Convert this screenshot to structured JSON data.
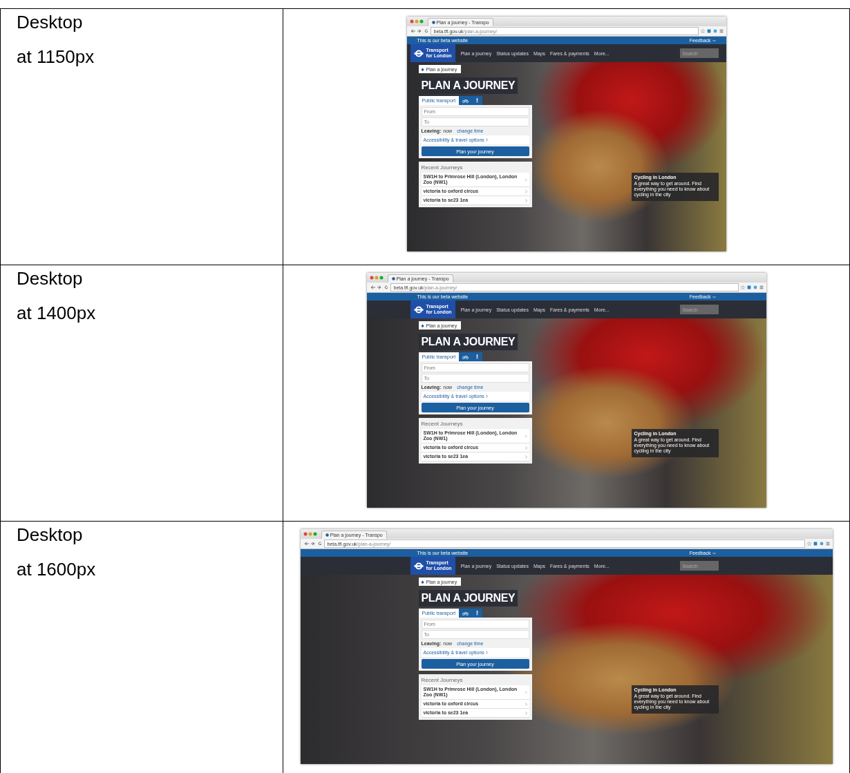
{
  "rows": [
    {
      "label": "Desktop",
      "sublabel": "at 1150px",
      "screenshot": {
        "browser": {
          "tab_title": "Plan a journey - Transpo",
          "url_host": "beta.tfl.gov.uk",
          "url_path": "/plan-a-journey/"
        },
        "beta_banner": {
          "text": "This is our beta website",
          "feedback": "Feedback"
        },
        "logo": {
          "line1": "Transport",
          "line2": "for London"
        },
        "nav": [
          "Plan a journey",
          "Status updates",
          "Maps",
          "Fares & payments",
          "More..."
        ],
        "search": {
          "placeholder": "Search"
        },
        "breadcrumb": "Plan a journey",
        "title": "PLAN A JOURNEY",
        "mode_tabs": [
          {
            "kind": "text",
            "label": "Public transport",
            "selected": true
          },
          {
            "kind": "cycle",
            "selected": false
          },
          {
            "kind": "walk",
            "selected": false
          }
        ],
        "from": {
          "placeholder": "From"
        },
        "to": {
          "placeholder": "To"
        },
        "leaving": {
          "label": "Leaving:",
          "value": "now",
          "link": "change time"
        },
        "options_link": "Accessibility & travel options",
        "submit": "Plan your journey",
        "recent": {
          "title": "Recent Journeys",
          "items": [
            "SW1H to Primrose Hill (London), London Zoo (NW1)",
            "victoria to oxford circus",
            "victoria to se23 1ea"
          ]
        },
        "caption": {
          "title": "Cycling in London",
          "text": "A great way to get around. Find everything you need to know about cycling in the city"
        }
      }
    },
    {
      "label": "Desktop",
      "sublabel": "at 1400px",
      "screenshot": {
        "browser": {
          "tab_title": "Plan a journey - Transpo",
          "url_host": "beta.tfl.gov.uk",
          "url_path": "/plan-a-journey/"
        },
        "beta_banner": {
          "text": "This is our beta website",
          "feedback": "Feedback"
        },
        "logo": {
          "line1": "Transport",
          "line2": "for London"
        },
        "nav": [
          "Plan a journey",
          "Status updates",
          "Maps",
          "Fares & payments",
          "More..."
        ],
        "search": {
          "placeholder": "Search"
        },
        "breadcrumb": "Plan a journey",
        "title": "PLAN A JOURNEY",
        "mode_tabs": [
          {
            "kind": "text",
            "label": "Public transport",
            "selected": true
          },
          {
            "kind": "cycle",
            "selected": false
          },
          {
            "kind": "walk",
            "selected": false
          }
        ],
        "from": {
          "placeholder": "From"
        },
        "to": {
          "placeholder": "To"
        },
        "leaving": {
          "label": "Leaving:",
          "value": "now",
          "link": "change time"
        },
        "options_link": "Accessibility & travel options",
        "submit": "Plan your journey",
        "recent": {
          "title": "Recent Journeys",
          "items": [
            "SW1H to Primrose Hill (London), London Zoo (NW1)",
            "victoria to oxford circus",
            "victoria to se23 1ea"
          ]
        },
        "caption": {
          "title": "Cycling in London",
          "text": "A great way to get around. Find everything you need to know about cycling in the city"
        }
      }
    },
    {
      "label": "Desktop",
      "sublabel": "at 1600px",
      "screenshot": {
        "browser": {
          "tab_title": "Plan a journey - Transpo",
          "url_host": "beta.tfl.gov.uk",
          "url_path": "/plan-a-journey/"
        },
        "beta_banner": {
          "text": "This is our beta website",
          "feedback": "Feedback"
        },
        "logo": {
          "line1": "Transport",
          "line2": "for London"
        },
        "nav": [
          "Plan a journey",
          "Status updates",
          "Maps",
          "Fares & payments",
          "More..."
        ],
        "search": {
          "placeholder": "Search"
        },
        "breadcrumb": "Plan a journey",
        "title": "PLAN A JOURNEY",
        "mode_tabs": [
          {
            "kind": "text",
            "label": "Public transport",
            "selected": true
          },
          {
            "kind": "cycle",
            "selected": false
          },
          {
            "kind": "walk",
            "selected": false
          }
        ],
        "from": {
          "placeholder": "From"
        },
        "to": {
          "placeholder": "To"
        },
        "leaving": {
          "label": "Leaving:",
          "value": "now",
          "link": "change time"
        },
        "options_link": "Accessibility & travel options",
        "submit": "Plan your journey",
        "recent": {
          "title": "Recent Journeys",
          "items": [
            "SW1H to Primrose Hill (London), London Zoo (NW1)",
            "victoria to oxford circus",
            "victoria to se23 1ea"
          ]
        },
        "caption": {
          "title": "Cycling in London",
          "text": "A great way to get around. Find everything you need to know about cycling in the city"
        }
      }
    }
  ]
}
